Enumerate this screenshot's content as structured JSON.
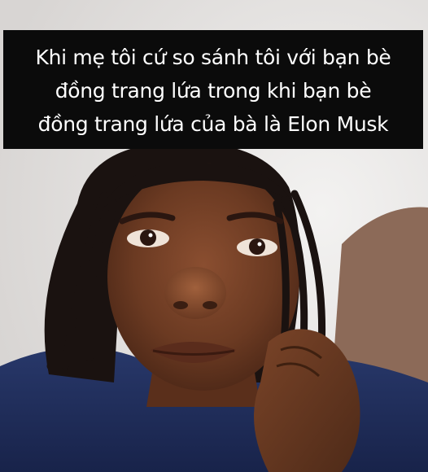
{
  "caption": {
    "lines": [
      "Khi mẹ tôi cứ so sánh tôi với bạn bè",
      "đồng trang lứa trong khi bạn bè",
      "đồng trang lứa của bà là Elon Musk"
    ]
  },
  "colors": {
    "caption_background": "#0b0b0b",
    "caption_text": "#ffffff",
    "shirt": "#1f2d5a",
    "skin": "#6b3a22",
    "hair": "#1a1210",
    "wall": "#e9e7e6"
  },
  "photo": {
    "subject": "young-person-selfie"
  }
}
